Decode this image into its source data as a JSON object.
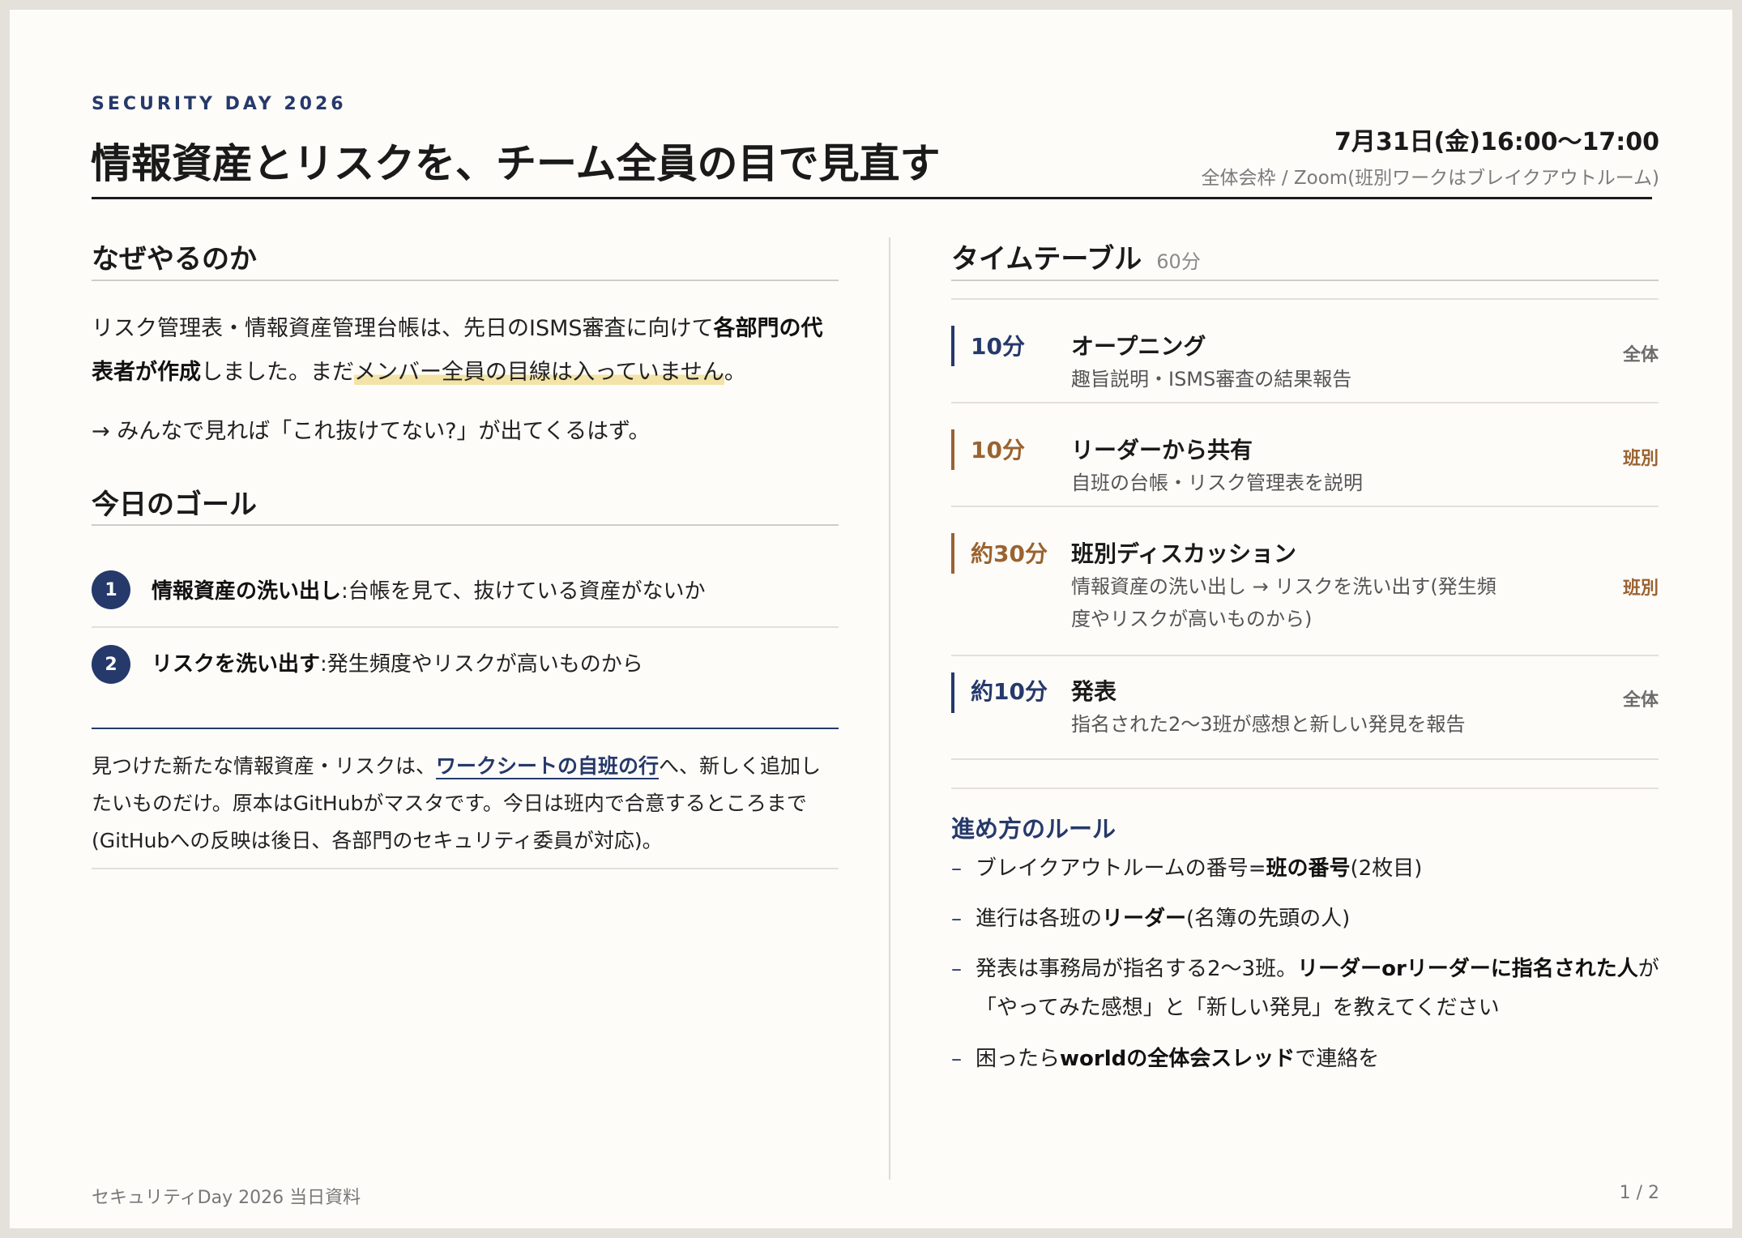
{
  "header": {
    "eyebrow": "SECURITY DAY 2026",
    "title": "情報資産とリスクを、チーム全員の目で見直す",
    "datetime": "7月31日(金)16:00〜17:00",
    "venue": "全体会枠 / Zoom(班別ワークはブレイクアウトルーム)"
  },
  "why": {
    "heading": "なぜやるのか",
    "p1_a": "リスク管理表・情報資産管理台帳は、先日のISMS審査に向けて",
    "p1_bold": "各部門の代表者が作成",
    "p1_b": "しました。まだ",
    "p1_highlight": "メンバー全員の目線は入っていません",
    "p1_c": "。",
    "p2": "→ みんなで見れば「これ抜けてない?」が出てくるはず。"
  },
  "goals": {
    "heading": "今日のゴール",
    "items": [
      {
        "num": "1",
        "bold": "情報資産の洗い出し",
        "rest": ":台帳を見て、抜けている資産がないか"
      },
      {
        "num": "2",
        "bold": "リスクを洗い出す",
        "rest": ":発生頻度やリスクが高いものから"
      }
    ]
  },
  "note": {
    "a": "見つけた新たな情報資産・リスクは、",
    "link": "ワークシートの自班の行",
    "b": "へ、新しく追加したいものだけ。原本はGitHubがマスタです。今日は班内で合意するところまで(GitHubへの反映は後日、各部門のセキュリティ委員が対応)。"
  },
  "timetable": {
    "heading": "タイムテーブル",
    "total": "60分",
    "rows": [
      {
        "duration": "10分",
        "name": "オープニング",
        "desc": "趣旨説明・ISMS審査の結果報告",
        "tag": "全体",
        "color": "#26396b"
      },
      {
        "duration": "10分",
        "name": "リーダーから共有",
        "desc": "自班の台帳・リスク管理表を説明",
        "tag": "班別",
        "color": "#9a6330"
      },
      {
        "duration": "約30分",
        "name": "班別ディスカッション",
        "desc": "情報資産の洗い出し → リスクを洗い出す(発生頻度やリスクが高いものから)",
        "tag": "班別",
        "color": "#9a6330"
      },
      {
        "duration": "約10分",
        "name": "発表",
        "desc": "指名された2〜3班が感想と新しい発見を報告",
        "tag": "全体",
        "color": "#26396b"
      }
    ]
  },
  "rules": {
    "heading": "進め方のルール",
    "items": [
      {
        "a": "ブレイクアウトルームの番号=",
        "bold": "班の番号",
        "b": "(2枚目)"
      },
      {
        "a": "進行は各班の",
        "bold": "リーダー",
        "b": "(名簿の先頭の人)"
      },
      {
        "a": "発表は事務局が指名する2〜3班。",
        "bold": "リーダーorリーダーに指名された人",
        "b": "が「やってみた感想」と「新しい発見」を教えてください"
      },
      {
        "a": "困ったら",
        "bold": "worldの全体会スレッド",
        "b": "で連絡を"
      }
    ]
  },
  "footer": {
    "left": "セキュリティDay 2026 当日資料",
    "right": "1 / 2"
  }
}
